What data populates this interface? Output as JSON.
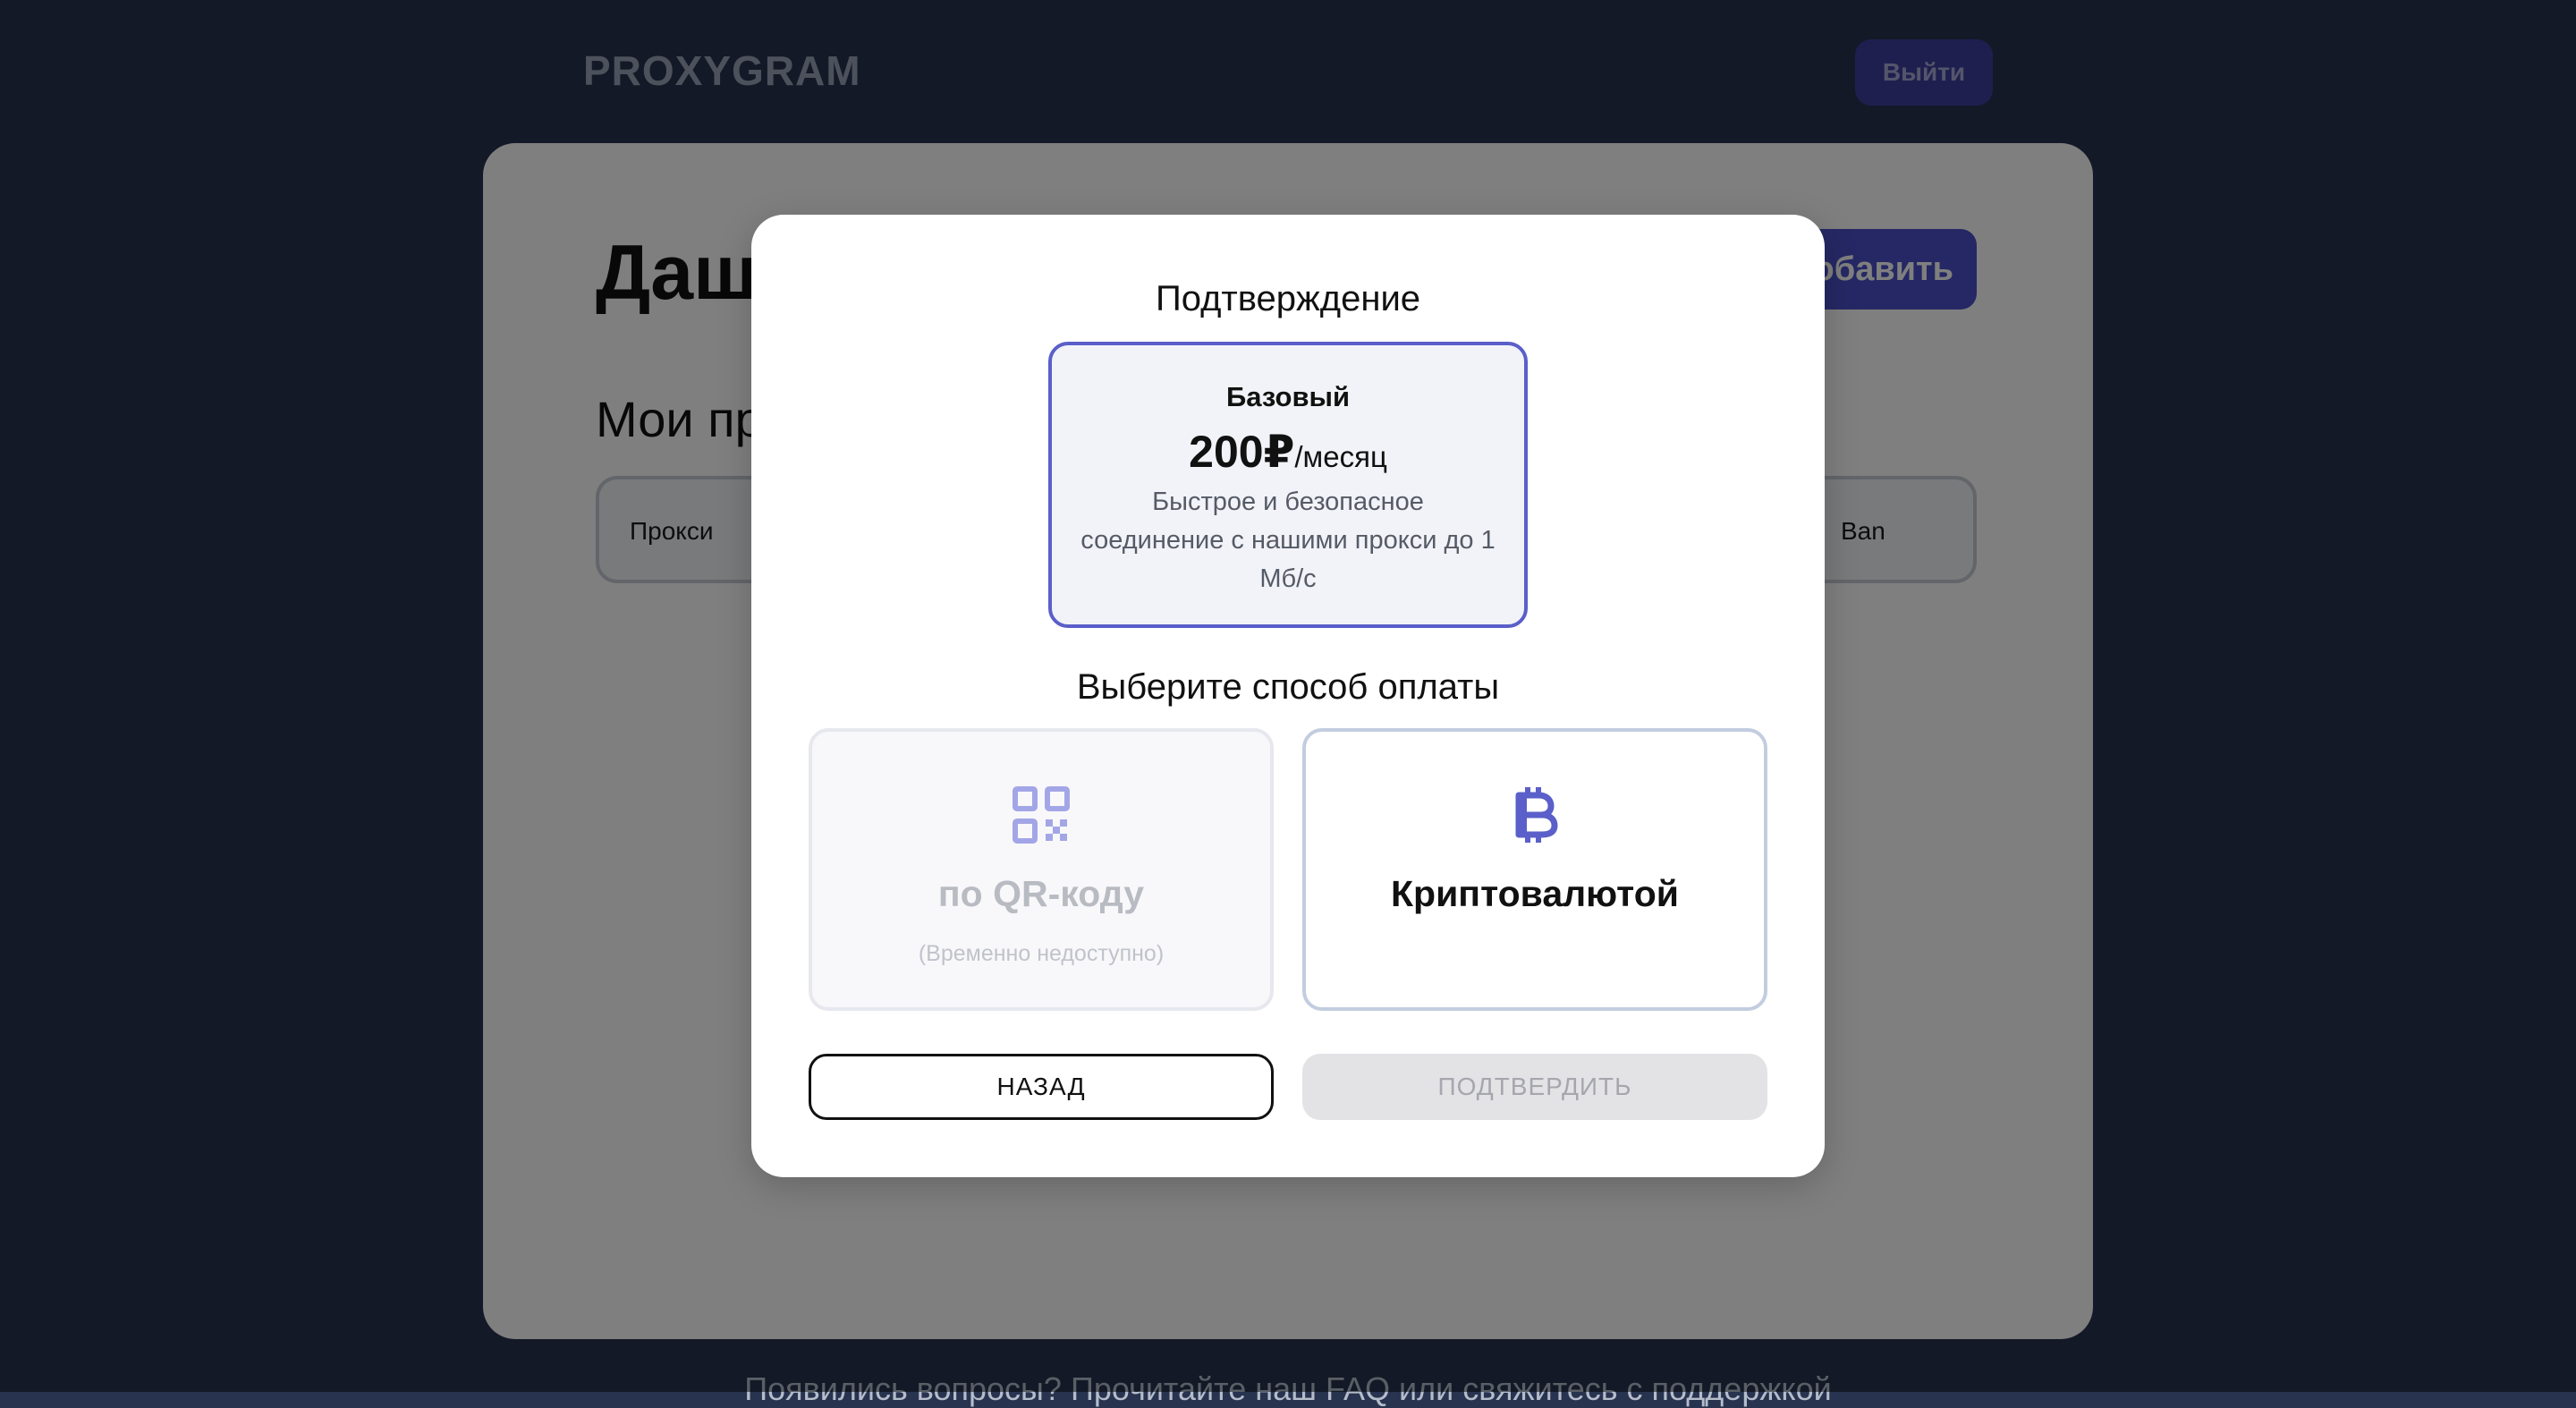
{
  "header": {
    "logo": "PROXYGRAM",
    "logout_label": "Выйти"
  },
  "dashboard": {
    "title": "Дашборд",
    "add_label": "Добавить",
    "section_title": "Мои прокси",
    "table_headers": [
      "Прокси",
      "Ban"
    ]
  },
  "footer": {
    "text": "Появились вопросы? Прочитайте наш FAQ или свяжитесь с поддержкой"
  },
  "modal": {
    "title": "Подтверждение",
    "plan": {
      "name": "Базовый",
      "price": "200₽",
      "period": "/месяц",
      "description": "Быстрое и безопасное соединение с нашими прокси до 1 Мб/с"
    },
    "payment_title": "Выберите способ оплаты",
    "payment_options": [
      {
        "icon": "qr-code-icon",
        "label": "по QR-коду",
        "note": "(Временно недоступно)",
        "disabled": true
      },
      {
        "icon": "bitcoin-icon",
        "label": "Криптовалютой",
        "note": "",
        "disabled": false
      }
    ],
    "back_label": "НАЗАД",
    "confirm_label": "ПОДТВЕРДИТЬ"
  },
  "colors": {
    "background": "#28334f",
    "accent": "#5a5fc9",
    "icon": "#5a5fc9",
    "icon_disabled": "#a3a6e6"
  }
}
